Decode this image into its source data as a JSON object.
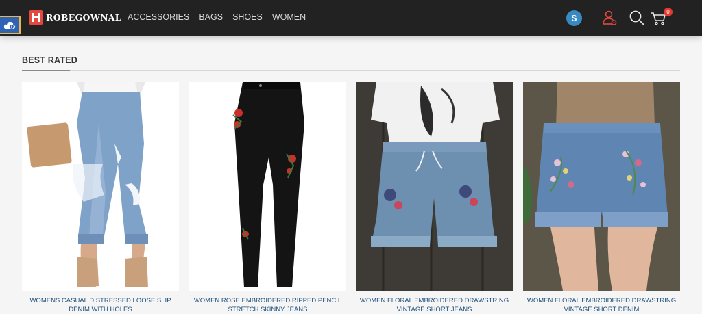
{
  "brand": {
    "name": "ROBEGOWNAL"
  },
  "nav": {
    "items": [
      "ACCESSORIES",
      "BAGS",
      "SHOES",
      "WOMEN"
    ]
  },
  "header": {
    "currency_symbol": "$",
    "cart_count": "0"
  },
  "section": {
    "title": "BEST RATED"
  },
  "products": [
    {
      "name": "WOMENS CASUAL DISTRESSED LOOSE SLIP DENIM WITH HOLES"
    },
    {
      "name": "WOMEN ROSE EMBROIDERED RIPPED PENCIL STRETCH SKINNY JEANS"
    },
    {
      "name": "WOMEN FLORAL EMBROIDERED DRAWSTRING VINTAGE SHORT JEANS"
    },
    {
      "name": "WOMEN FLORAL EMBROIDERED DRAWSTRING VINTAGE SHORT DENIM"
    }
  ],
  "colors": {
    "header_bg": "#222222",
    "brand_red": "#e4483e",
    "link_blue": "#1d4f79",
    "currency_blue": "#3a8ac2",
    "side_tab_blue": "#2e63b5"
  }
}
